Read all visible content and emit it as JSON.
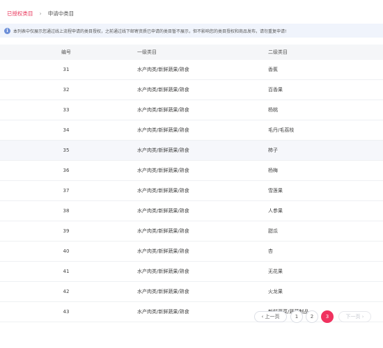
{
  "breadcrumb": {
    "active": "已授权类目",
    "separator": "›",
    "current": "申请中类目"
  },
  "notice": {
    "icon": "info-icon",
    "text": "本列表中仅展示您通过线上流程申请的类目授权，之前通过线下邮寄资质已申请的类目暂不展示，但不影响您的类目授权和商品发布，请勿重复申请!"
  },
  "table": {
    "headers": [
      "编号",
      "一级类目",
      "二级类目"
    ],
    "rows": [
      {
        "id": "31",
        "cat1": "水产肉类/新鲜蔬果/熟食",
        "cat2": "香蕉"
      },
      {
        "id": "32",
        "cat1": "水产肉类/新鲜蔬果/熟食",
        "cat2": "百香果"
      },
      {
        "id": "33",
        "cat1": "水产肉类/新鲜蔬果/熟食",
        "cat2": "杨桃"
      },
      {
        "id": "34",
        "cat1": "水产肉类/新鲜蔬果/熟食",
        "cat2": "毛丹/毛荔枝"
      },
      {
        "id": "35",
        "cat1": "水产肉类/新鲜蔬果/熟食",
        "cat2": "柿子"
      },
      {
        "id": "36",
        "cat1": "水产肉类/新鲜蔬果/熟食",
        "cat2": "杨梅"
      },
      {
        "id": "37",
        "cat1": "水产肉类/新鲜蔬果/熟食",
        "cat2": "雪莲果"
      },
      {
        "id": "38",
        "cat1": "水产肉类/新鲜蔬果/熟食",
        "cat2": "人参果"
      },
      {
        "id": "39",
        "cat1": "水产肉类/新鲜蔬果/熟食",
        "cat2": "甜瓜"
      },
      {
        "id": "40",
        "cat1": "水产肉类/新鲜蔬果/熟食",
        "cat2": "杏"
      },
      {
        "id": "41",
        "cat1": "水产肉类/新鲜蔬果/熟食",
        "cat2": "无花果"
      },
      {
        "id": "42",
        "cat1": "水产肉类/新鲜蔬果/熟食",
        "cat2": "火龙果"
      },
      {
        "id": "43",
        "cat1": "水产肉类/新鲜蔬果/熟食",
        "cat2": "新鲜蔬菜/蔬菜制品"
      }
    ],
    "highlighted_row": 4
  },
  "pagination": {
    "prev": "‹ 上一页",
    "pages": [
      "1",
      "2",
      "3"
    ],
    "current": "3",
    "next": "下一页 ›"
  },
  "colors": {
    "accent": "#f0325f",
    "notice_bg": "#f0f4fc",
    "header_bg": "#f5f6f8"
  }
}
